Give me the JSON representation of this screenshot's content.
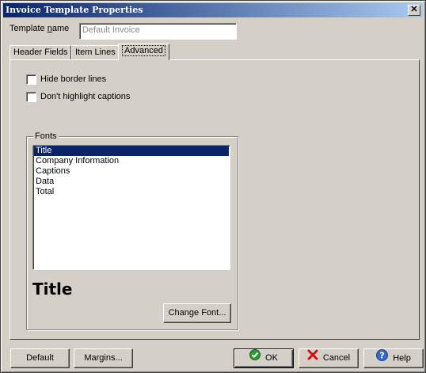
{
  "window": {
    "title": "Invoice Template Properties",
    "close_glyph": "✕"
  },
  "template_name": {
    "label_prefix": "Template ",
    "label_accel": "n",
    "label_suffix": "ame",
    "value": "Default Invoice"
  },
  "tabs": [
    {
      "label": "Header Fields"
    },
    {
      "label": "Item Lines"
    },
    {
      "label": "Advanced"
    }
  ],
  "options": {
    "hide_border_lines": {
      "label": "Hide border lines",
      "checked": false
    },
    "dont_highlight_captions": {
      "label": "Don't highlight captions",
      "checked": false
    }
  },
  "fonts": {
    "group_title": "Fonts",
    "items": [
      "Title",
      "Company Information",
      "Captions",
      "Data",
      "Total"
    ],
    "selected": "Title",
    "preview_text": "Title",
    "change_font_label": "Change Font..."
  },
  "buttons": {
    "default": "Default",
    "margins": "Margins...",
    "ok": "OK",
    "cancel": "Cancel",
    "help": "Help"
  },
  "colors": {
    "titlebar_start": "#0a246a",
    "titlebar_end": "#a6caf0",
    "selection": "#0a246a",
    "face": "#d4d0c8"
  },
  "icons": {
    "ok": "green-check-icon",
    "cancel": "red-x-icon",
    "help": "question-mark-icon"
  }
}
